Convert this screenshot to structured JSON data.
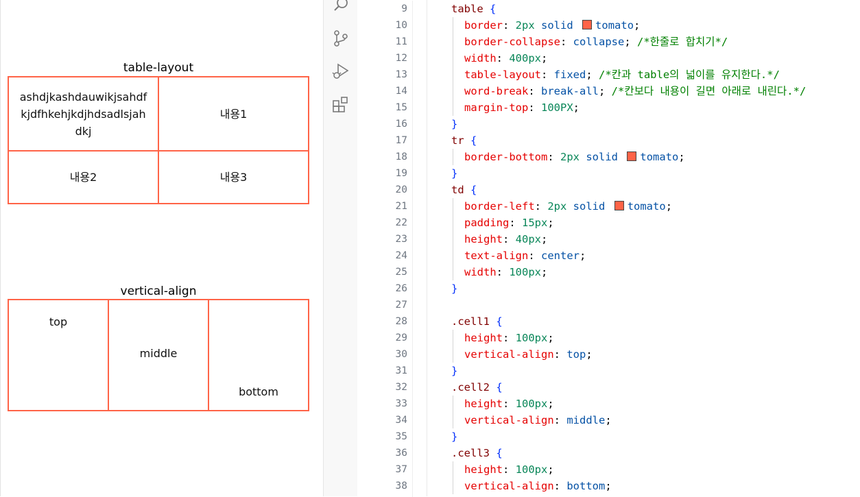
{
  "preview": {
    "caption1": "table-layout",
    "table1": [
      [
        "ashdjkashdauwikjsahdfkjdfhkehjkdjhdsadlsjahdkj",
        "내용1"
      ],
      [
        "내용2",
        "내용3"
      ]
    ],
    "caption2": "vertical-align",
    "table2": [
      "top",
      "middle",
      "bottom"
    ]
  },
  "activity_bar": [
    "search-icon",
    "source-control-icon",
    "run-debug-icon",
    "extensions-icon"
  ],
  "editor": {
    "line_numbers": [
      "9",
      "10",
      "11",
      "12",
      "13",
      "14",
      "15",
      "16",
      "17",
      "18",
      "19",
      "20",
      "21",
      "22",
      "23",
      "24",
      "25",
      "26",
      "27",
      "28",
      "29",
      "30",
      "31",
      "32",
      "33",
      "34",
      "35",
      "36",
      "37",
      "38"
    ],
    "code": {
      "l9": {
        "selector": "table"
      },
      "l10": {
        "prop": "border",
        "val1": "2px",
        "val2": "solid",
        "color": "tomato"
      },
      "l11": {
        "prop": "border-collapse",
        "val": "collapse",
        "comment": "/*한줄로 합치기*/"
      },
      "l12": {
        "prop": "width",
        "val": "400px"
      },
      "l13": {
        "prop": "table-layout",
        "val": "fixed",
        "comment": "/*칸과 table의 넓이를 유지한다.*/"
      },
      "l14": {
        "prop": "word-break",
        "val": "break-all",
        "comment": "/*칸보다 내용이 길면 아래로 내린다.*/"
      },
      "l15": {
        "prop": "margin-top",
        "val": "100PX"
      },
      "l17": {
        "selector": "tr"
      },
      "l18": {
        "prop": "border-bottom",
        "val1": "2px",
        "val2": "solid",
        "color": "tomato"
      },
      "l20": {
        "selector": "td"
      },
      "l21": {
        "prop": "border-left",
        "val1": "2px",
        "val2": "solid",
        "color": "tomato"
      },
      "l22": {
        "prop": "padding",
        "val": "15px"
      },
      "l23": {
        "prop": "height",
        "val": "40px"
      },
      "l24": {
        "prop": "text-align",
        "val": "center"
      },
      "l25": {
        "prop": "width",
        "val": "100px"
      },
      "l28": {
        "selector": ".cell1"
      },
      "l29": {
        "prop": "height",
        "val": "100px"
      },
      "l30": {
        "prop": "vertical-align",
        "val": "top"
      },
      "l32": {
        "selector": ".cell2"
      },
      "l33": {
        "prop": "height",
        "val": "100px"
      },
      "l34": {
        "prop": "vertical-align",
        "val": "middle"
      },
      "l36": {
        "selector": ".cell3"
      },
      "l37": {
        "prop": "height",
        "val": "100px"
      },
      "l38": {
        "prop": "vertical-align",
        "val": "bottom"
      }
    }
  },
  "colors": {
    "tomato": "#ff6347"
  }
}
